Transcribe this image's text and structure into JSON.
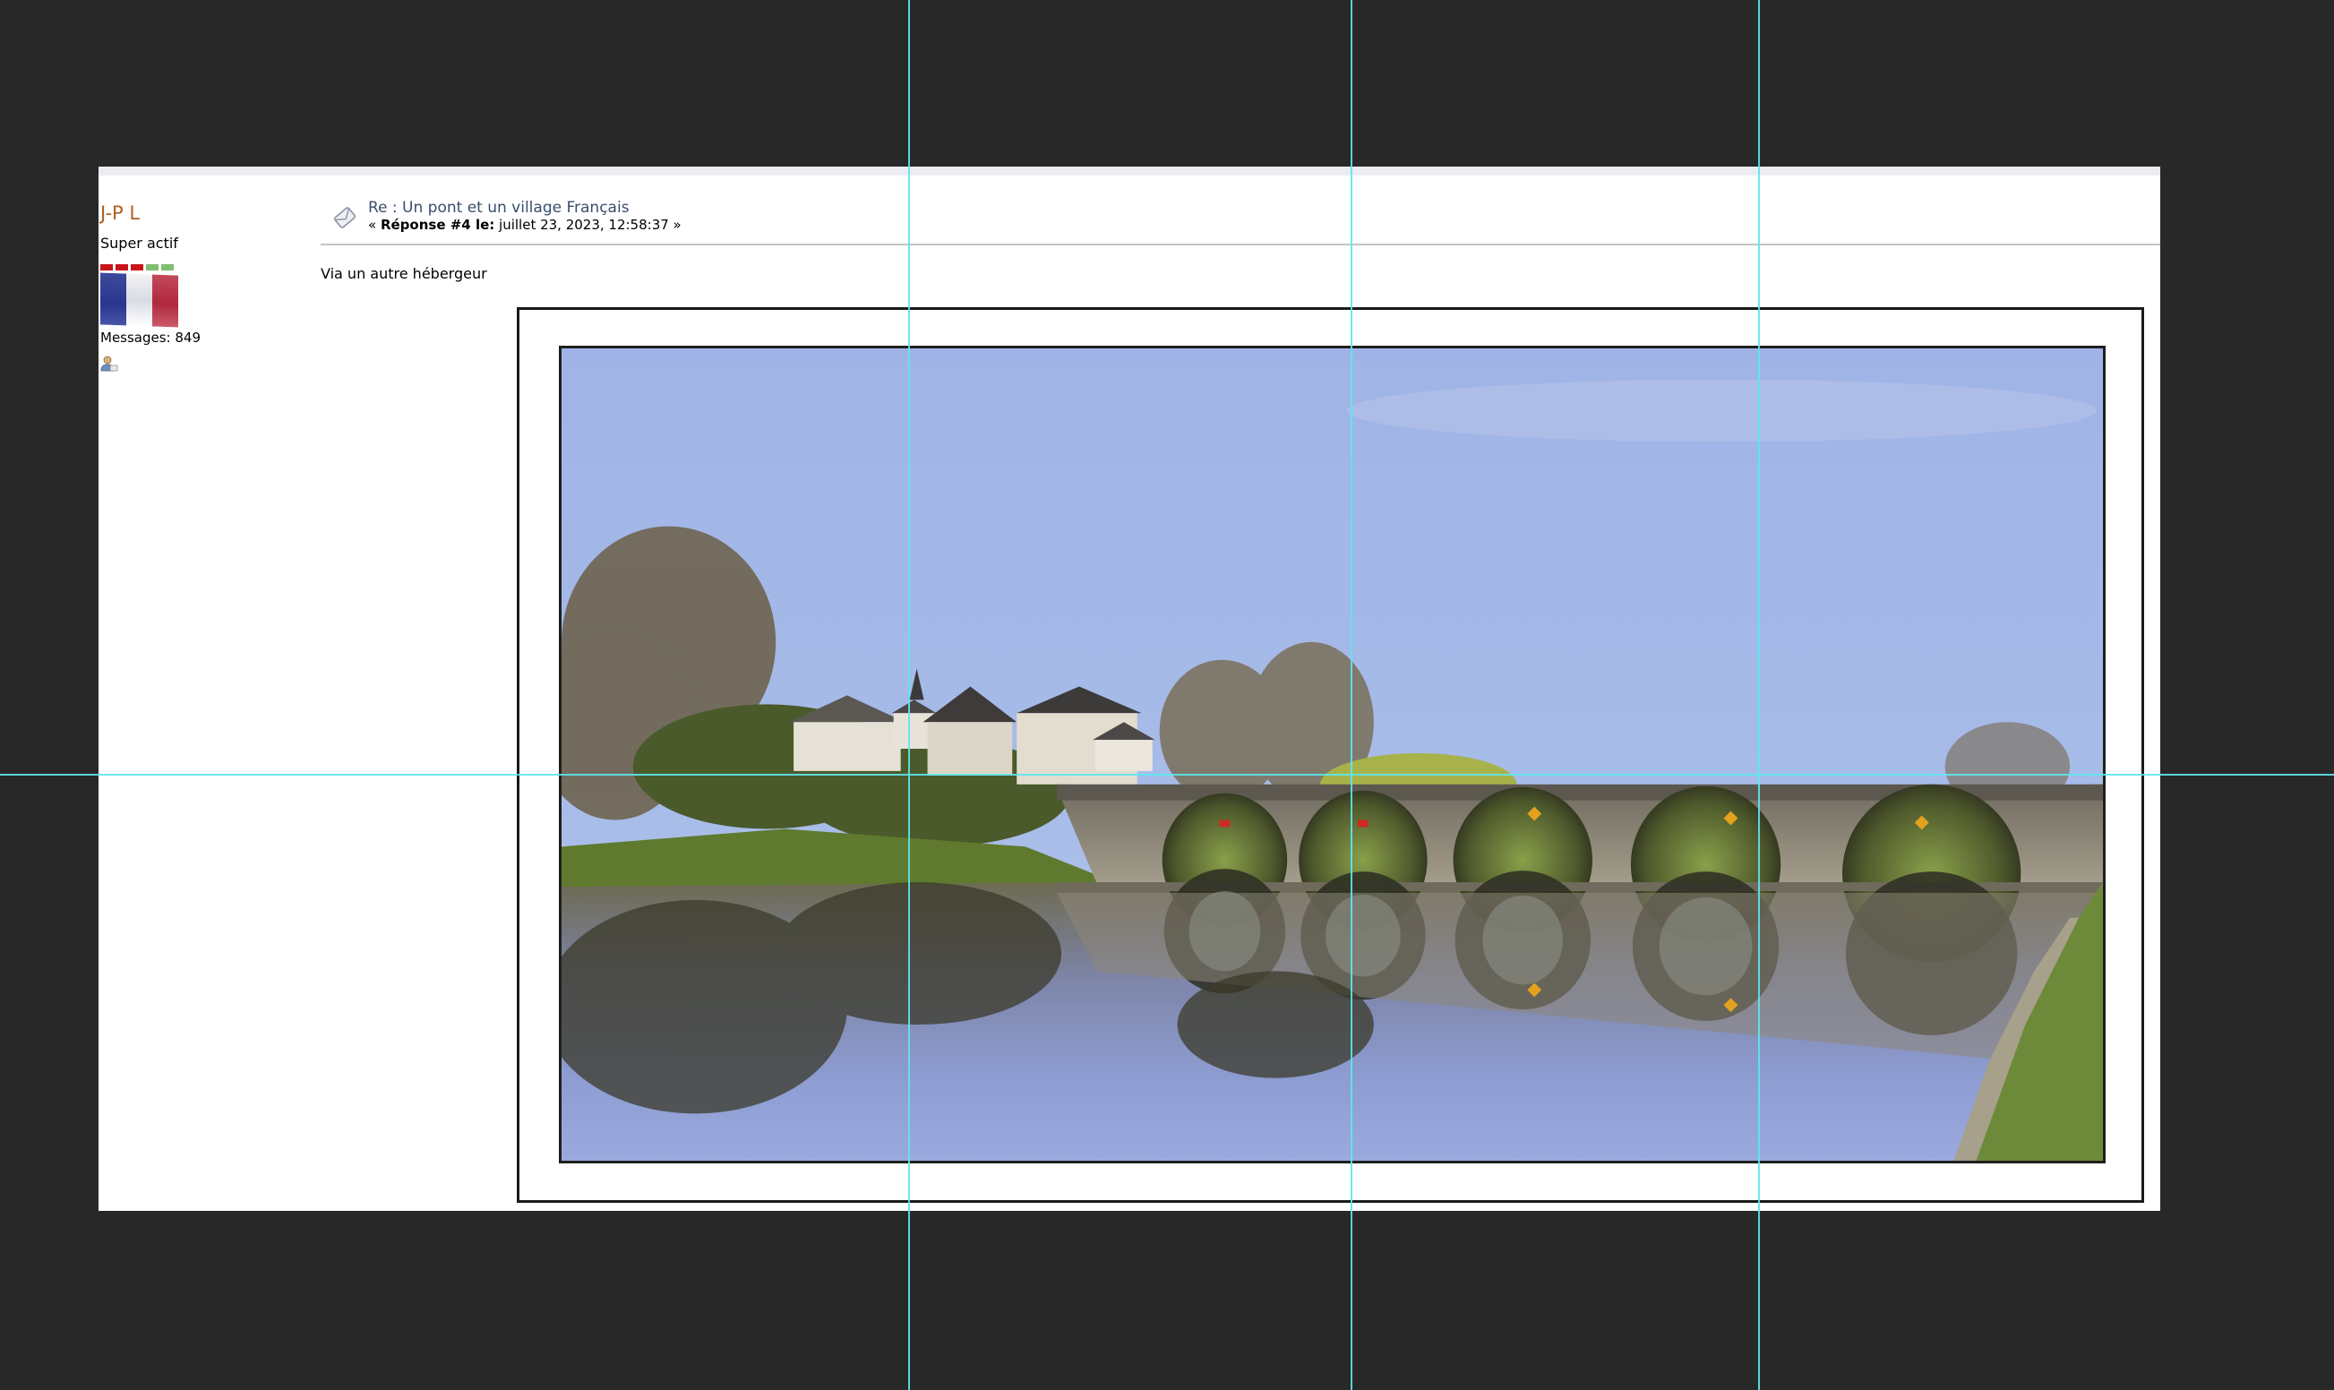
{
  "poster": {
    "name": "J-P L",
    "rank": "Super actif",
    "stars": [
      "red",
      "red",
      "red",
      "green",
      "green"
    ],
    "posts": "Messages: 849",
    "flag_icon": "french-flag",
    "profile_icon": "profile-icon"
  },
  "post": {
    "subject": "Re : Un pont et un village Français",
    "meta_prefix": "« ",
    "meta_label": "Réponse #4 le:",
    "meta_date": " juillet 23, 2023, 12:58:37 »",
    "body": "Via un autre hébergeur",
    "message_icon": "message-icon",
    "image_description": "bridge-reflection-photo"
  },
  "colors": {
    "background": "#282828",
    "guide": "#5ee6ee",
    "poster_name": "#b0601e",
    "subject": "#3a4d6e"
  }
}
